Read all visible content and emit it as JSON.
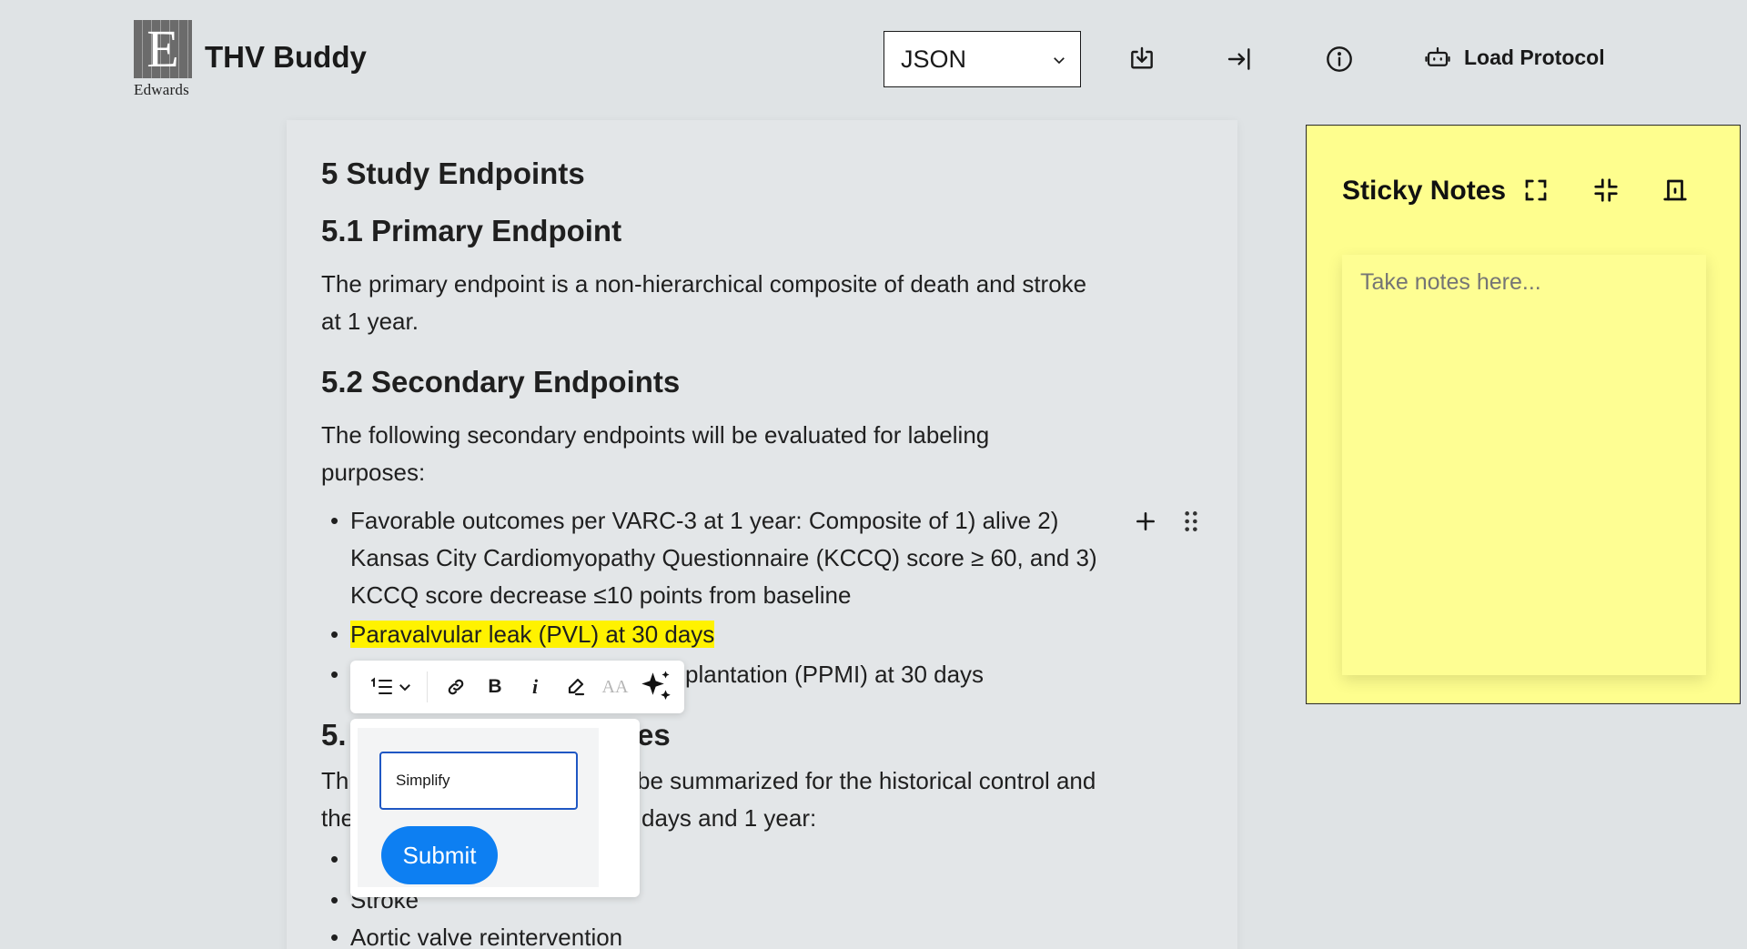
{
  "header": {
    "logo_word": "Edwards",
    "logo_letter": "E",
    "title": "THV Buddy",
    "format_select": {
      "value": "JSON",
      "options": [
        "JSON"
      ]
    },
    "icons": [
      "download-icon",
      "export-icon",
      "info-icon",
      "robot-icon"
    ],
    "load_protocol_label": "Load Protocol"
  },
  "document": {
    "h_section": "5 Study Endpoints",
    "h_primary": "5.1 Primary Endpoint",
    "primary_text_1": "The primary endpoint is a non-hierarchical composite of death and stroke",
    "primary_text_2": "at 1 year.",
    "h_secondary": "5.2 Secondary Endpoints",
    "secondary_text_1": "The following secondary endpoints will be evaluated for labeling",
    "secondary_text_2": "purposes:",
    "bullet1_line1": "Favorable outcomes per VARC-3 at 1 year: Composite of 1) alive 2)",
    "bullet1_line2": "Kansas City Cardiomyopathy Questionnaire (KCCQ) score ≥ 60, and 3)",
    "bullet1_line3": "KCCQ score decrease ≤10 points from baseline",
    "bullet2": "Paravalvular leak (PVL) at 30 days",
    "bullet3_visible": "plantation (PPMI) at 30 days",
    "h_next_left": "5.",
    "h_next_right": "es",
    "next_text_1_left": "Th",
    "next_text_1_right": "be summarized for the historical control and",
    "next_text_2_left": "the",
    "next_text_2_right": "days and 1 year:",
    "bullet_stroke": "Stroke",
    "bullet_partial": "Aortic valve reintervention"
  },
  "toolbar": {
    "icons": [
      "numbered-list-icon",
      "chevron-down-icon",
      "link-icon",
      "bold-icon",
      "italic-icon",
      "highlight-icon",
      "font-size-icon",
      "sparkle-icon"
    ],
    "bold_label": "B",
    "italic_label": "i",
    "font_label": "AA"
  },
  "ai_popup": {
    "input_value": "Simplify",
    "submit_label": "Submit"
  },
  "sticky_notes": {
    "title": "Sticky Notes",
    "placeholder": "Take notes here...",
    "icons": [
      "expand-icon",
      "collapse-icon",
      "pin-icon"
    ],
    "background": "#fefe8e"
  },
  "colors": {
    "highlight": "#fff200",
    "submit": "#0d7ff2",
    "input_border": "#1f57c3"
  }
}
